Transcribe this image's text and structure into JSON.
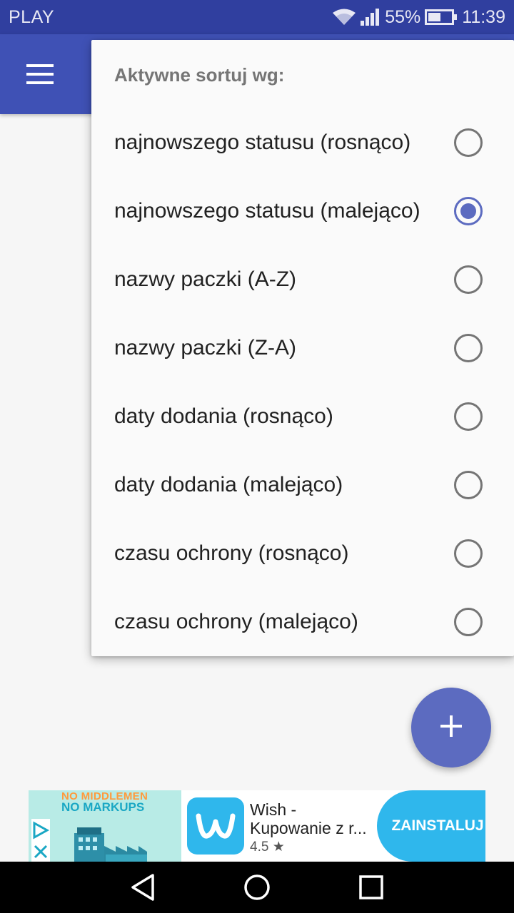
{
  "status_bar": {
    "carrier": "PLAY",
    "battery": "55%",
    "time": "11:39",
    "icons": [
      "wifi-icon",
      "signal-icon",
      "battery-icon"
    ]
  },
  "app_bar": {
    "menu_icon": "hamburger-menu-icon"
  },
  "sort_menu": {
    "title": "Aktywne sortuj wg:",
    "selected_index": 1,
    "options": [
      {
        "label": "najnowszego statusu (rosnąco)",
        "checked": false
      },
      {
        "label": "najnowszego statusu (malejąco)",
        "checked": true
      },
      {
        "label": "nazwy paczki (A-Z)",
        "checked": false
      },
      {
        "label": "nazwy paczki (Z-A)",
        "checked": false
      },
      {
        "label": "daty dodania (rosnąco)",
        "checked": false
      },
      {
        "label": "daty dodania (malejąco)",
        "checked": false
      },
      {
        "label": "czasu ochrony (rosnąco)",
        "checked": false
      },
      {
        "label": "czasu ochrony (malejąco)",
        "checked": false
      }
    ]
  },
  "fab": {
    "icon": "plus-icon"
  },
  "ad": {
    "line1": "NO MIDDLEMEN",
    "line2": "NO MARKUPS",
    "app_name": "Wish - Kupowanie z r...",
    "rating": "4.5",
    "install_label": "ZAINSTALUJ"
  },
  "nav_bar": {
    "icons": [
      "back-icon",
      "home-icon",
      "recents-icon"
    ]
  },
  "colors": {
    "status_bar": "#303f9f",
    "app_bar": "#3f51b5",
    "accent": "#5c6bc0",
    "ad_blue": "#2fb7ec"
  }
}
